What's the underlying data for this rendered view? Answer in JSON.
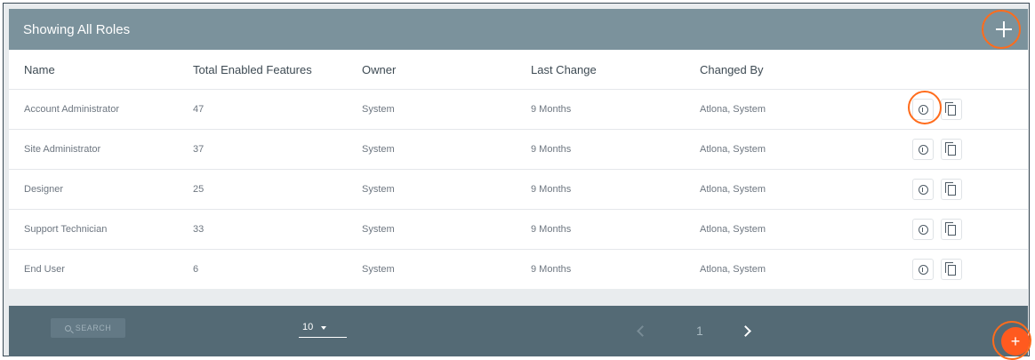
{
  "header": {
    "title": "Showing All Roles"
  },
  "columns": [
    "Name",
    "Total Enabled Features",
    "Owner",
    "Last Change",
    "Changed By"
  ],
  "rows": [
    {
      "name": "Account Administrator",
      "features": "47",
      "owner": "System",
      "last_change": "9 Months",
      "changed_by": "Atlona, System"
    },
    {
      "name": "Site Administrator",
      "features": "37",
      "owner": "System",
      "last_change": "9 Months",
      "changed_by": "Atlona, System"
    },
    {
      "name": "Designer",
      "features": "25",
      "owner": "System",
      "last_change": "9 Months",
      "changed_by": "Atlona, System"
    },
    {
      "name": "Support Technician",
      "features": "33",
      "owner": "System",
      "last_change": "9 Months",
      "changed_by": "Atlona, System"
    },
    {
      "name": "End User",
      "features": "6",
      "owner": "System",
      "last_change": "9 Months",
      "changed_by": "Atlona, System"
    }
  ],
  "footer": {
    "search_label": "SEARCH",
    "per_page": "10",
    "current_page": "1",
    "fab_label": "+"
  },
  "icons": [
    "plus-icon",
    "info-icon",
    "copy-icon",
    "search-icon",
    "chevron-down-icon",
    "chevron-left-icon",
    "chevron-right-icon"
  ],
  "colors": {
    "header": "#7b929c",
    "footer": "#546a75",
    "accent": "#ff5a1f",
    "highlight_ring": "#ff6c1c"
  }
}
